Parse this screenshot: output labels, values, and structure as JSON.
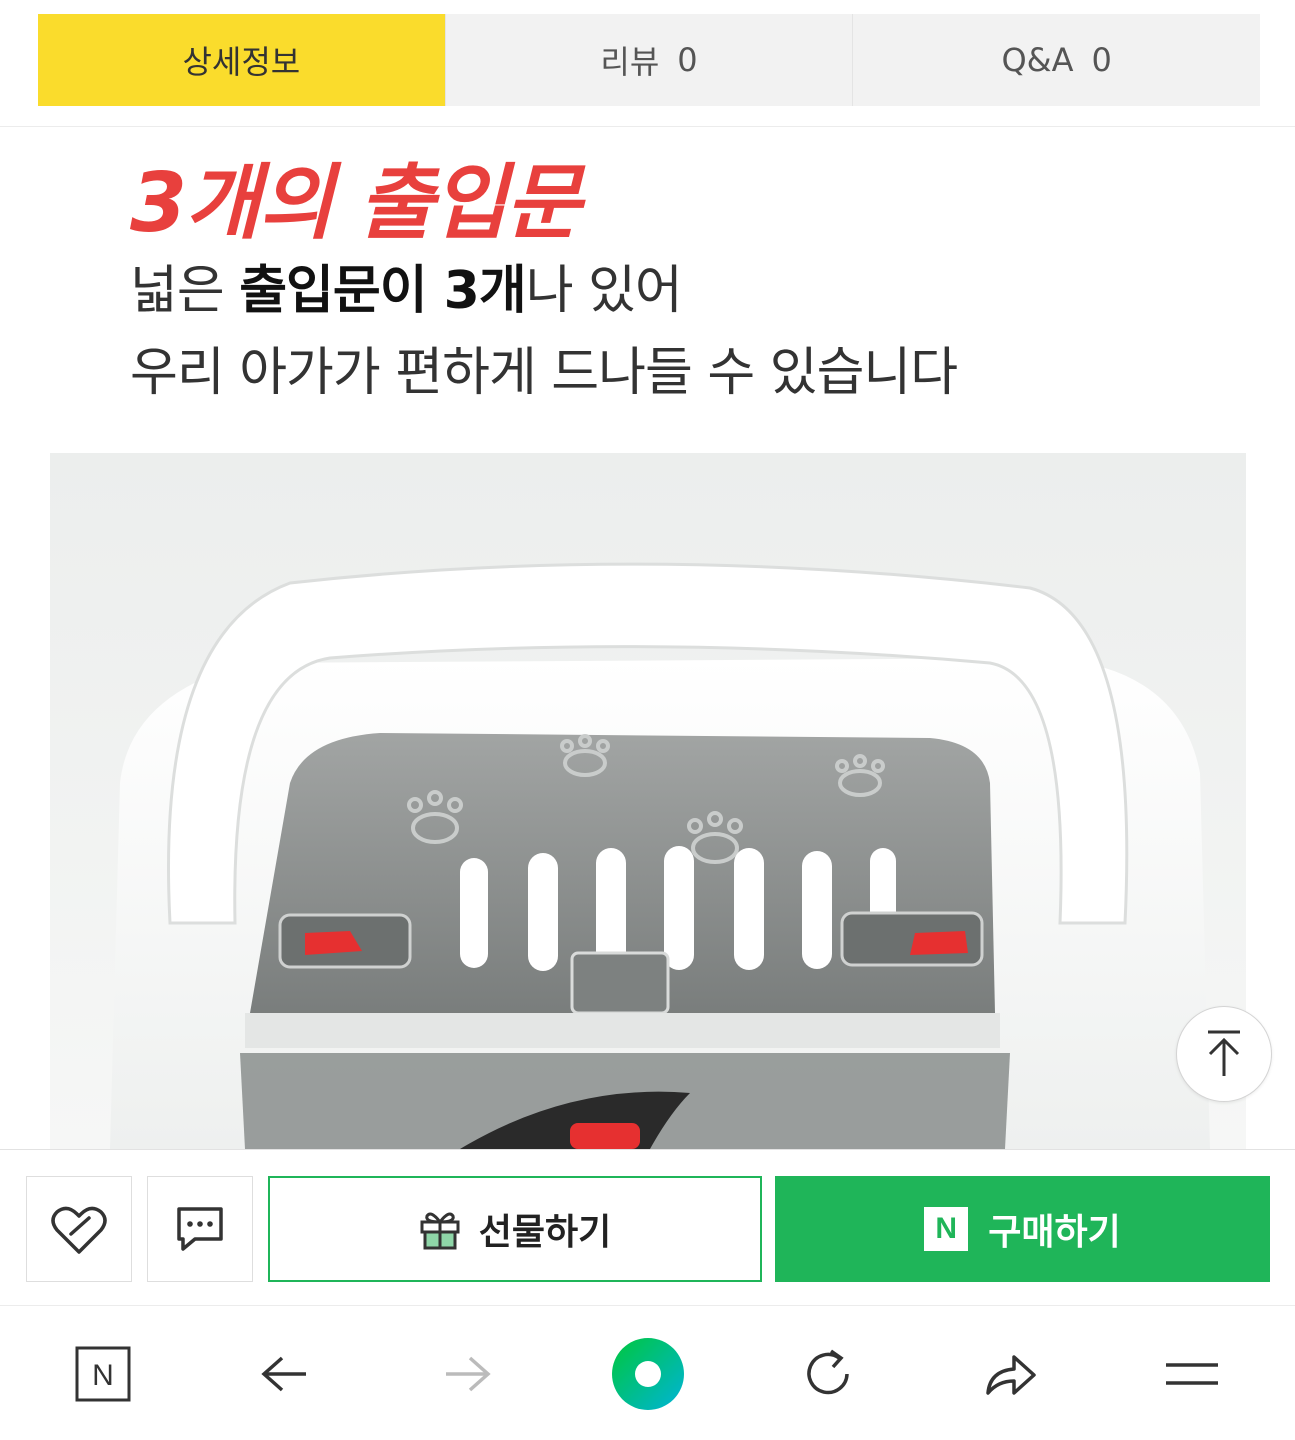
{
  "tabs": [
    {
      "label": "상세정보",
      "count": ""
    },
    {
      "label": "리뷰",
      "count": "0"
    },
    {
      "label": "Q&A",
      "count": "0"
    }
  ],
  "content": {
    "headline": "3개의 출입문",
    "line1": {
      "prefix": "넓은 ",
      "bold": "출입문이 3개",
      "suffix": "나 있어"
    },
    "line2": "우리 아가가 편하게 드나들 수 있습니다"
  },
  "purchase_bar": {
    "gift_label": "선물하기",
    "buy_badge": "N",
    "buy_label": "구매하기"
  },
  "nav": {
    "home_badge": "N"
  },
  "colors": {
    "tab_active": "#fadc2c",
    "headline": "#e8403d",
    "naver_green": "#1fb559",
    "door_latch": "#e63030"
  },
  "icons": [
    "heart-icon",
    "chat-icon",
    "gift-icon",
    "naver-n-icon",
    "arrow-up-icon",
    "back-arrow-icon",
    "forward-arrow-icon",
    "green-dot-icon",
    "refresh-icon",
    "share-icon",
    "menu-icon"
  ]
}
